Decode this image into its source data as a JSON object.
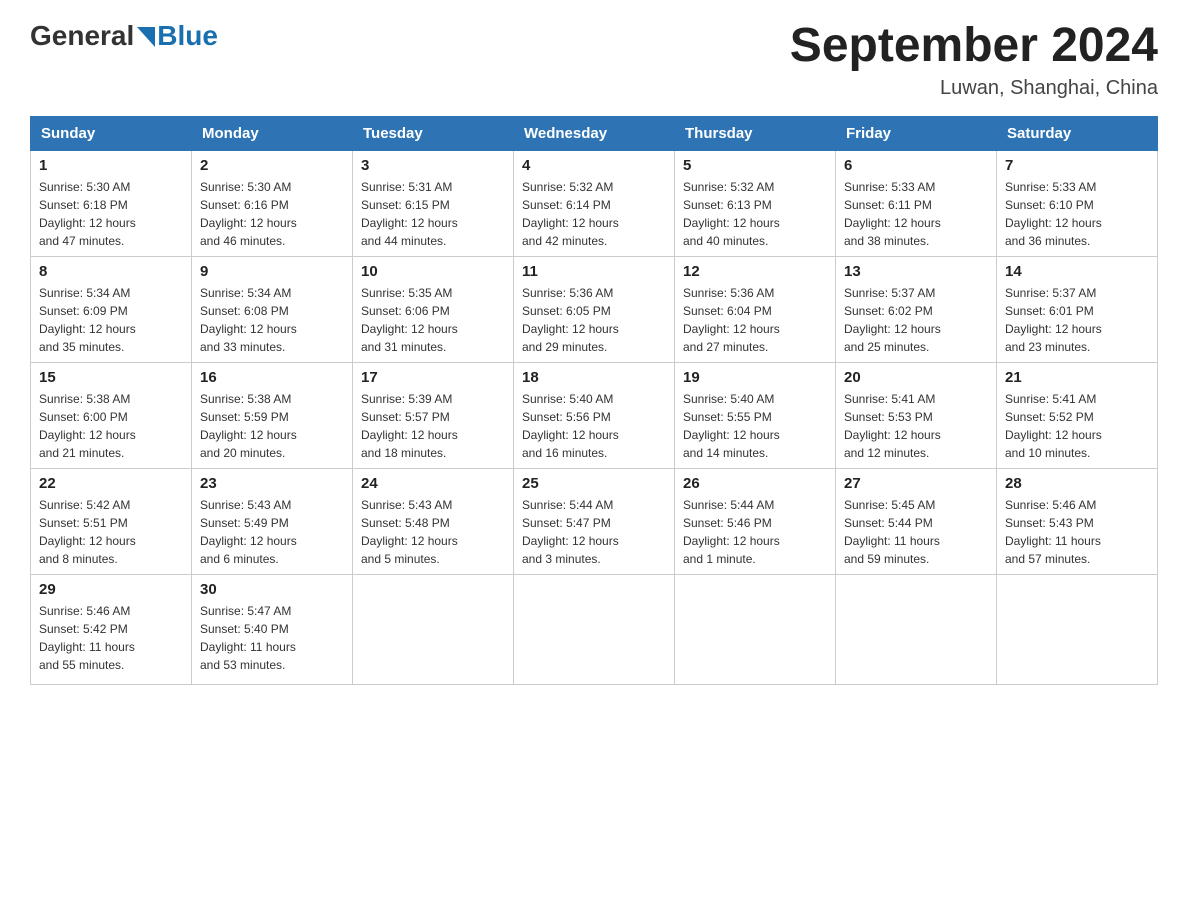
{
  "header": {
    "logo_general": "General",
    "logo_blue": "Blue",
    "title": "September 2024",
    "subtitle": "Luwan, Shanghai, China"
  },
  "days_of_week": [
    "Sunday",
    "Monday",
    "Tuesday",
    "Wednesday",
    "Thursday",
    "Friday",
    "Saturday"
  ],
  "weeks": [
    [
      {
        "num": "1",
        "sunrise": "5:30 AM",
        "sunset": "6:18 PM",
        "daylight": "12 hours and 47 minutes."
      },
      {
        "num": "2",
        "sunrise": "5:30 AM",
        "sunset": "6:16 PM",
        "daylight": "12 hours and 46 minutes."
      },
      {
        "num": "3",
        "sunrise": "5:31 AM",
        "sunset": "6:15 PM",
        "daylight": "12 hours and 44 minutes."
      },
      {
        "num": "4",
        "sunrise": "5:32 AM",
        "sunset": "6:14 PM",
        "daylight": "12 hours and 42 minutes."
      },
      {
        "num": "5",
        "sunrise": "5:32 AM",
        "sunset": "6:13 PM",
        "daylight": "12 hours and 40 minutes."
      },
      {
        "num": "6",
        "sunrise": "5:33 AM",
        "sunset": "6:11 PM",
        "daylight": "12 hours and 38 minutes."
      },
      {
        "num": "7",
        "sunrise": "5:33 AM",
        "sunset": "6:10 PM",
        "daylight": "12 hours and 36 minutes."
      }
    ],
    [
      {
        "num": "8",
        "sunrise": "5:34 AM",
        "sunset": "6:09 PM",
        "daylight": "12 hours and 35 minutes."
      },
      {
        "num": "9",
        "sunrise": "5:34 AM",
        "sunset": "6:08 PM",
        "daylight": "12 hours and 33 minutes."
      },
      {
        "num": "10",
        "sunrise": "5:35 AM",
        "sunset": "6:06 PM",
        "daylight": "12 hours and 31 minutes."
      },
      {
        "num": "11",
        "sunrise": "5:36 AM",
        "sunset": "6:05 PM",
        "daylight": "12 hours and 29 minutes."
      },
      {
        "num": "12",
        "sunrise": "5:36 AM",
        "sunset": "6:04 PM",
        "daylight": "12 hours and 27 minutes."
      },
      {
        "num": "13",
        "sunrise": "5:37 AM",
        "sunset": "6:02 PM",
        "daylight": "12 hours and 25 minutes."
      },
      {
        "num": "14",
        "sunrise": "5:37 AM",
        "sunset": "6:01 PM",
        "daylight": "12 hours and 23 minutes."
      }
    ],
    [
      {
        "num": "15",
        "sunrise": "5:38 AM",
        "sunset": "6:00 PM",
        "daylight": "12 hours and 21 minutes."
      },
      {
        "num": "16",
        "sunrise": "5:38 AM",
        "sunset": "5:59 PM",
        "daylight": "12 hours and 20 minutes."
      },
      {
        "num": "17",
        "sunrise": "5:39 AM",
        "sunset": "5:57 PM",
        "daylight": "12 hours and 18 minutes."
      },
      {
        "num": "18",
        "sunrise": "5:40 AM",
        "sunset": "5:56 PM",
        "daylight": "12 hours and 16 minutes."
      },
      {
        "num": "19",
        "sunrise": "5:40 AM",
        "sunset": "5:55 PM",
        "daylight": "12 hours and 14 minutes."
      },
      {
        "num": "20",
        "sunrise": "5:41 AM",
        "sunset": "5:53 PM",
        "daylight": "12 hours and 12 minutes."
      },
      {
        "num": "21",
        "sunrise": "5:41 AM",
        "sunset": "5:52 PM",
        "daylight": "12 hours and 10 minutes."
      }
    ],
    [
      {
        "num": "22",
        "sunrise": "5:42 AM",
        "sunset": "5:51 PM",
        "daylight": "12 hours and 8 minutes."
      },
      {
        "num": "23",
        "sunrise": "5:43 AM",
        "sunset": "5:49 PM",
        "daylight": "12 hours and 6 minutes."
      },
      {
        "num": "24",
        "sunrise": "5:43 AM",
        "sunset": "5:48 PM",
        "daylight": "12 hours and 5 minutes."
      },
      {
        "num": "25",
        "sunrise": "5:44 AM",
        "sunset": "5:47 PM",
        "daylight": "12 hours and 3 minutes."
      },
      {
        "num": "26",
        "sunrise": "5:44 AM",
        "sunset": "5:46 PM",
        "daylight": "12 hours and 1 minute."
      },
      {
        "num": "27",
        "sunrise": "5:45 AM",
        "sunset": "5:44 PM",
        "daylight": "11 hours and 59 minutes."
      },
      {
        "num": "28",
        "sunrise": "5:46 AM",
        "sunset": "5:43 PM",
        "daylight": "11 hours and 57 minutes."
      }
    ],
    [
      {
        "num": "29",
        "sunrise": "5:46 AM",
        "sunset": "5:42 PM",
        "daylight": "11 hours and 55 minutes."
      },
      {
        "num": "30",
        "sunrise": "5:47 AM",
        "sunset": "5:40 PM",
        "daylight": "11 hours and 53 minutes."
      },
      {
        "num": "",
        "sunrise": "",
        "sunset": "",
        "daylight": ""
      },
      {
        "num": "",
        "sunrise": "",
        "sunset": "",
        "daylight": ""
      },
      {
        "num": "",
        "sunrise": "",
        "sunset": "",
        "daylight": ""
      },
      {
        "num": "",
        "sunrise": "",
        "sunset": "",
        "daylight": ""
      },
      {
        "num": "",
        "sunrise": "",
        "sunset": "",
        "daylight": ""
      }
    ]
  ],
  "labels": {
    "sunrise": "Sunrise:",
    "sunset": "Sunset:",
    "daylight": "Daylight:"
  }
}
